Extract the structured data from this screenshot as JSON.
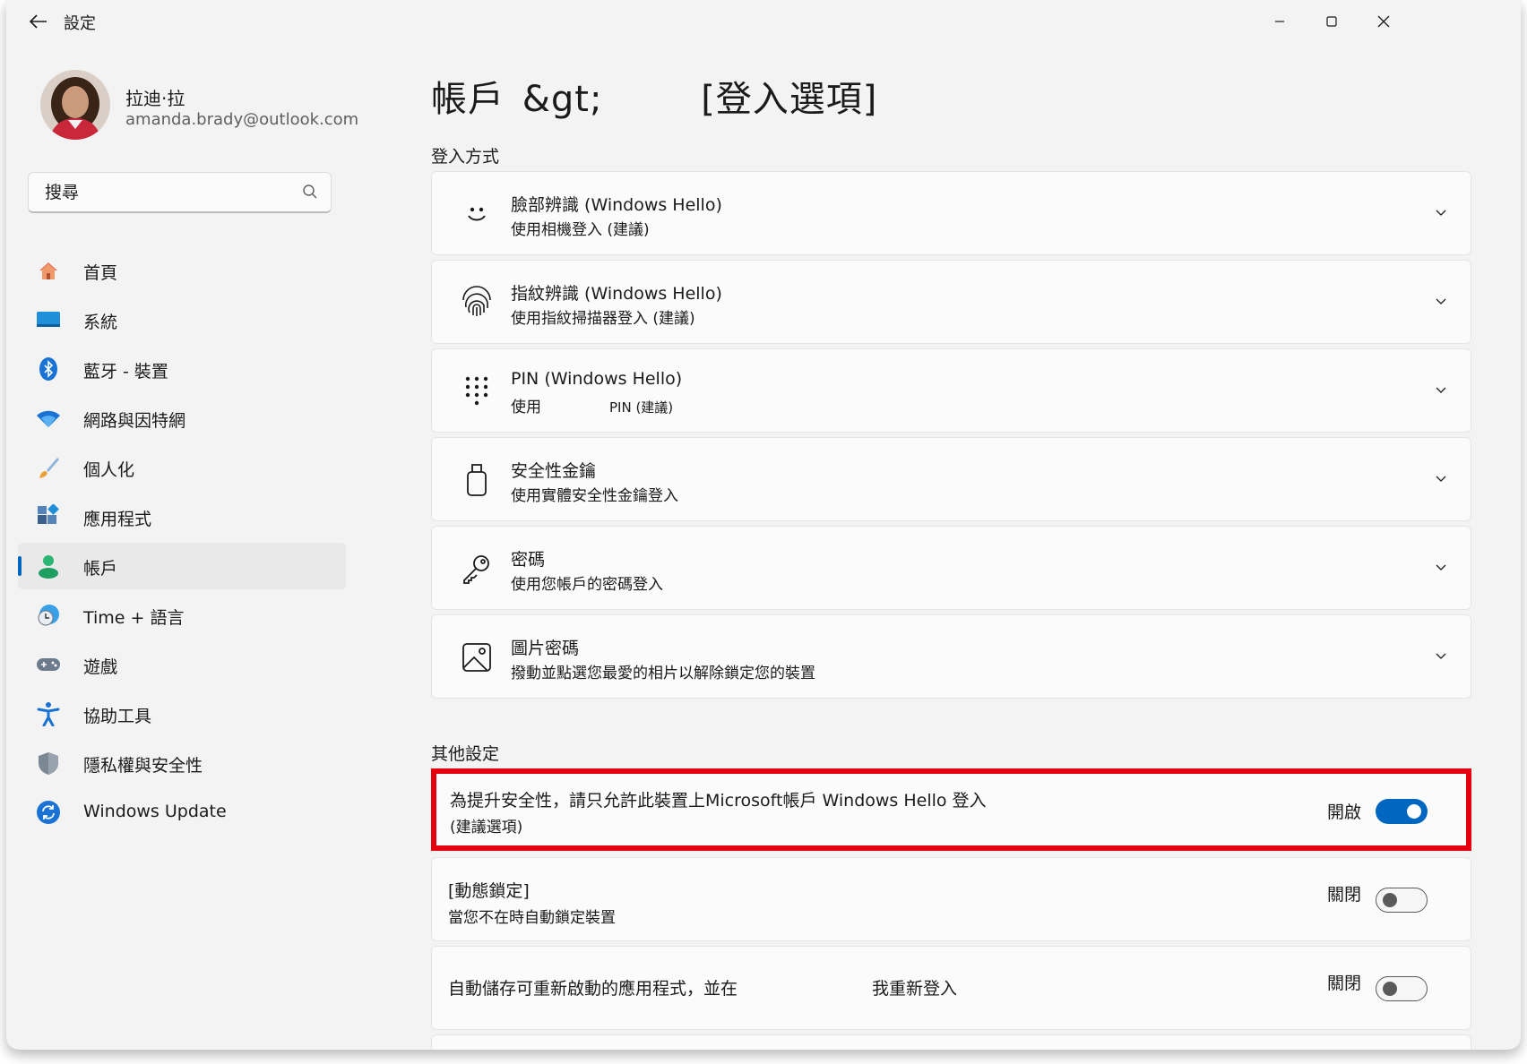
{
  "window": {
    "title": "設定"
  },
  "profile": {
    "name": "拉迪·拉",
    "email": "amanda.brady@outlook.com"
  },
  "search": {
    "placeholder": "搜尋"
  },
  "nav": {
    "items": [
      {
        "label": "首頁",
        "icon": "home-icon"
      },
      {
        "label": "系統",
        "icon": "system-display-icon"
      },
      {
        "label": "藍牙 - 裝置",
        "icon": "bluetooth-icon"
      },
      {
        "label": "網路與因特網",
        "icon": "wifi-icon"
      },
      {
        "label": "個人化",
        "icon": "paintbrush-icon"
      },
      {
        "label": "應用程式",
        "icon": "apps-icon"
      },
      {
        "label": "帳戶",
        "icon": "account-person-icon",
        "selected": true
      },
      {
        "label": "Time + 語言",
        "icon": "time-language-icon"
      },
      {
        "label": "遊戲",
        "icon": "gamepad-icon"
      },
      {
        "label": "協助工具",
        "icon": "accessibility-icon"
      },
      {
        "label": "隱私權與安全性",
        "icon": "shield-icon"
      },
      {
        "label": "Windows Update",
        "icon": "windows-update-icon"
      }
    ]
  },
  "page": {
    "breadcrumb_parent": "帳戶",
    "breadcrumb_sep": "&gt;",
    "title": "[登入選項]"
  },
  "signin": {
    "header": "登入方式",
    "options": [
      {
        "title": "臉部辨識 (Windows Hello)",
        "subtitle": "使用相機登入 (建議)",
        "icon": "face-icon"
      },
      {
        "title": "指紋辨識 (Windows Hello)",
        "subtitle": "使用指紋掃描器登入 (建議)",
        "icon": "fingerprint-icon"
      },
      {
        "title": "PIN (Windows Hello)",
        "subtitle_a": "使用",
        "subtitle_b": "PIN (建議)",
        "icon": "pin-keypad-icon"
      },
      {
        "title": "安全性金鑰",
        "subtitle": "使用實體安全性金鑰登入",
        "icon": "security-key-icon"
      },
      {
        "title": "密碼",
        "subtitle": "使用您帳戶的密碼登入",
        "icon": "key-icon"
      },
      {
        "title": "圖片密碼",
        "subtitle": "撥動並點選您最愛的相片以解除鎖定您的裝置",
        "icon": "picture-icon"
      }
    ]
  },
  "other": {
    "header": "其他設定",
    "settings": [
      {
        "title": "為提升安全性，請只允許此裝置上Microsoft帳戶 Windows Hello 登入",
        "subtitle": "(建議選項)",
        "state_label": "開啟",
        "on": true
      },
      {
        "title": "[動態鎖定]",
        "subtitle": "當您不在時自動鎖定裝置",
        "state_label": "關閉",
        "on": false
      },
      {
        "title_a": "自動儲存可重新啟動的應用程式，並在",
        "title_b": "我重新登入",
        "state_label": "關閉",
        "on": false
      }
    ]
  },
  "colors": {
    "accent": "#0067c0",
    "highlight": "#e4000f"
  }
}
